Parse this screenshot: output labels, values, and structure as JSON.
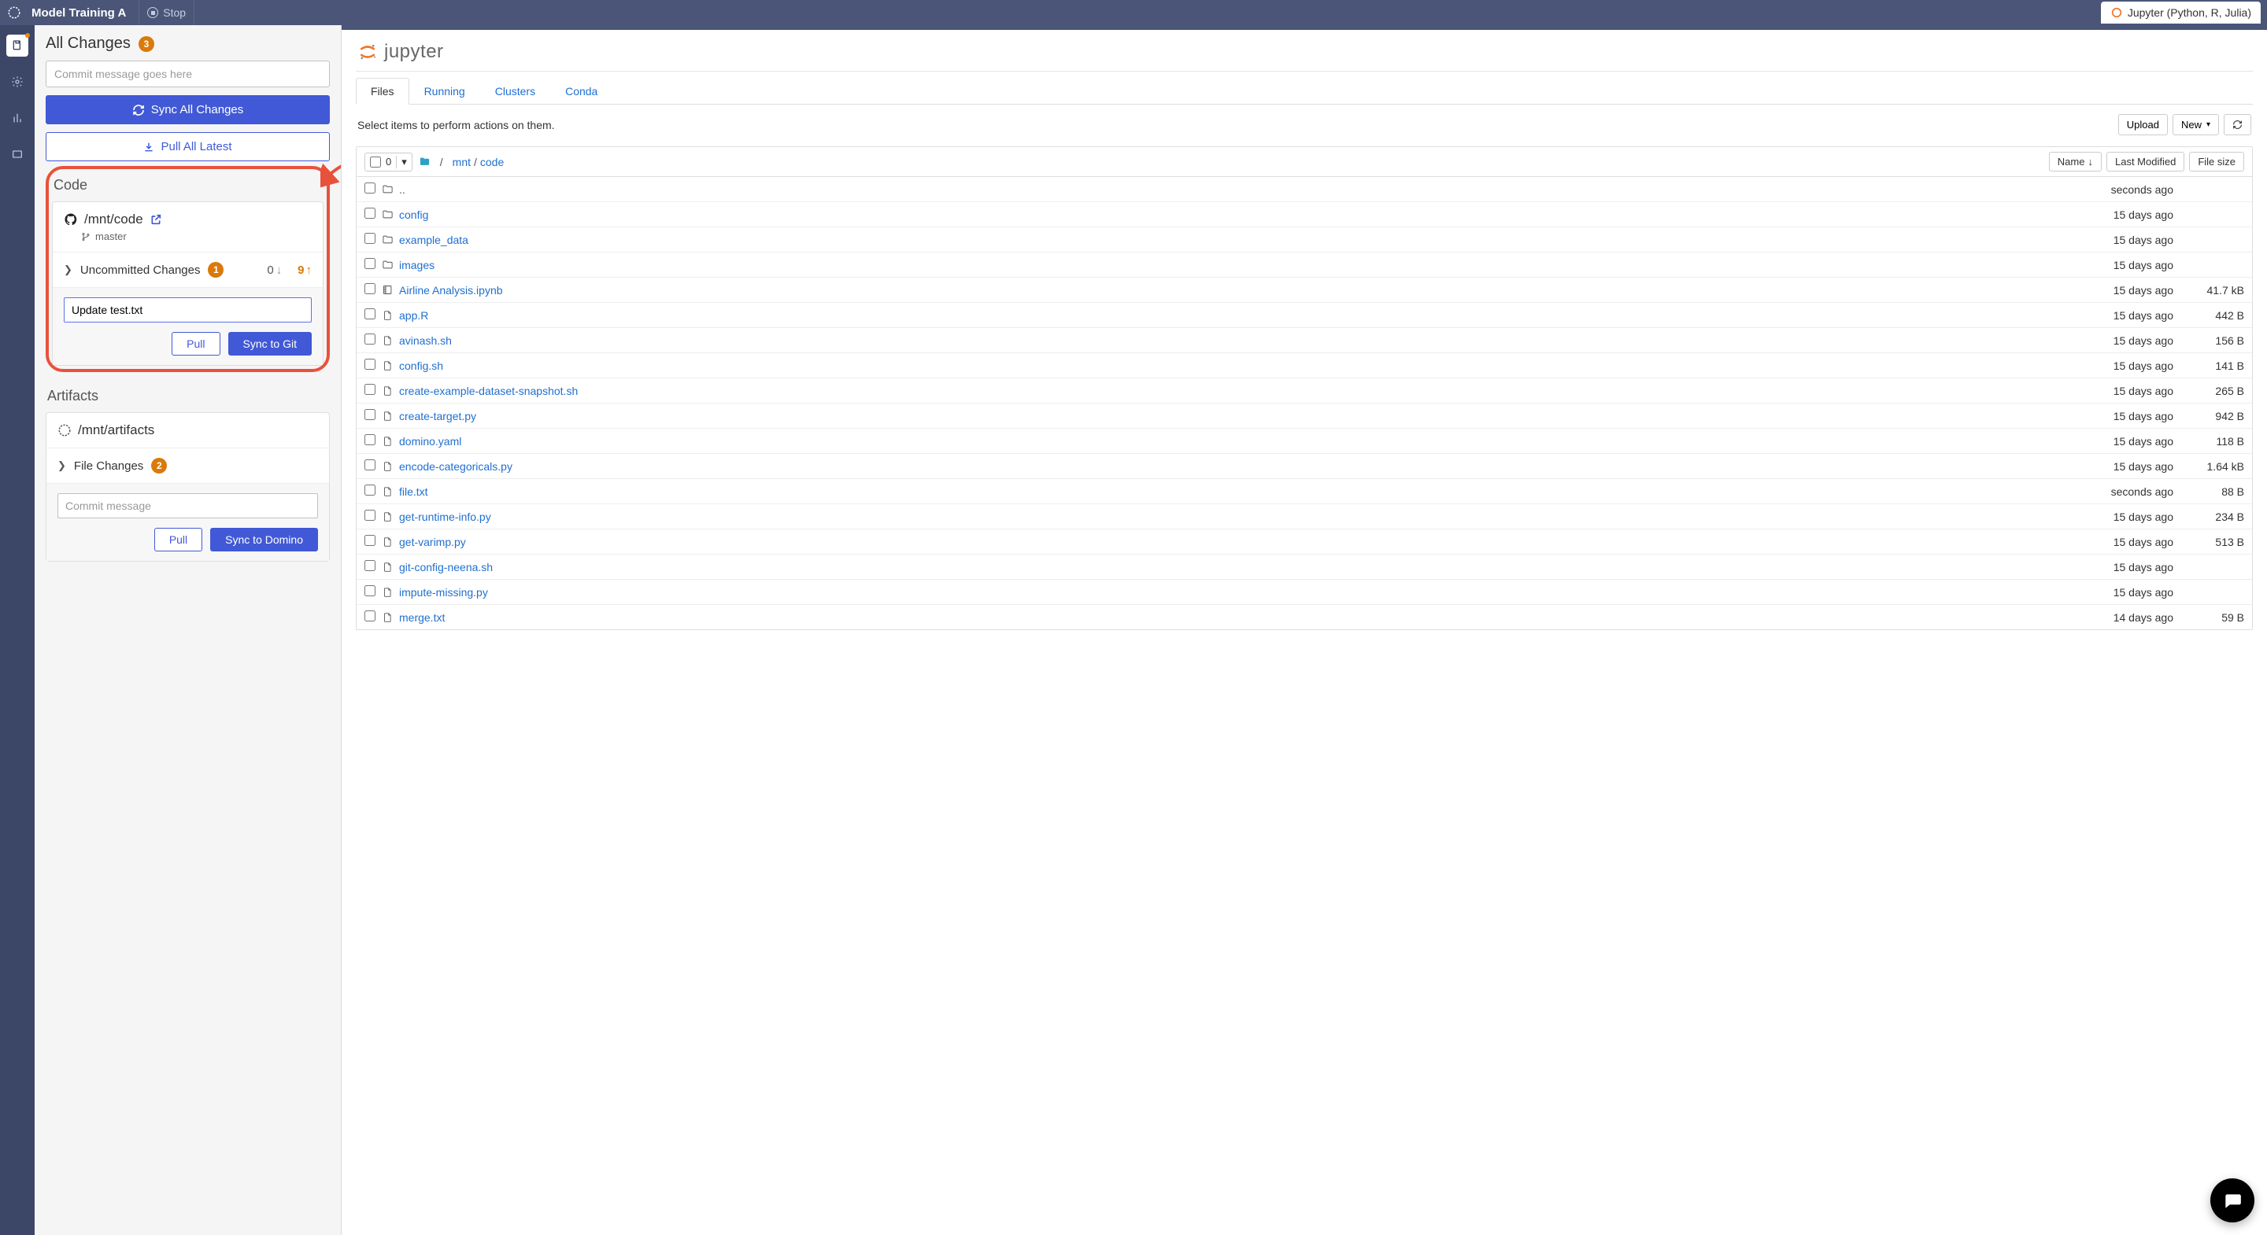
{
  "topbar": {
    "title": "Model Training A",
    "stop_label": "Stop",
    "right_label": "Jupyter (Python, R, Julia)"
  },
  "sidebar": {
    "all_changes_title": "All Changes",
    "all_changes_badge": "3",
    "commit_placeholder": "Commit message goes here",
    "sync_all_label": "Sync All Changes",
    "pull_all_label": "Pull All Latest",
    "code": {
      "section_title": "Code",
      "repo_path": "/mnt/code",
      "branch": "master",
      "uncommitted_label": "Uncommitted Changes",
      "uncommitted_badge": "1",
      "down_count": "0",
      "up_count": "9",
      "commit_value": "Update test.txt",
      "pull_label": "Pull",
      "sync_label": "Sync to Git"
    },
    "artifacts": {
      "section_title": "Artifacts",
      "repo_path": "/mnt/artifacts",
      "file_changes_label": "File Changes",
      "file_changes_badge": "2",
      "commit_placeholder": "Commit message",
      "pull_label": "Pull",
      "sync_label": "Sync to Domino"
    }
  },
  "jupyter": {
    "word": "jupyter",
    "tabs": [
      "Files",
      "Running",
      "Clusters",
      "Conda"
    ],
    "active_tab": "Files",
    "hint": "Select items to perform actions on them.",
    "upload_label": "Upload",
    "new_label": "New",
    "sel_count": "0",
    "breadcrumb": [
      "mnt",
      "code"
    ],
    "col_name": "Name",
    "col_modified": "Last Modified",
    "col_size": "File size",
    "rows": [
      {
        "icon": "folder",
        "name": "..",
        "modified": "seconds ago",
        "size": "",
        "dim": true
      },
      {
        "icon": "folder",
        "name": "config",
        "modified": "15 days ago",
        "size": ""
      },
      {
        "icon": "folder",
        "name": "example_data",
        "modified": "15 days ago",
        "size": ""
      },
      {
        "icon": "folder",
        "name": "images",
        "modified": "15 days ago",
        "size": ""
      },
      {
        "icon": "notebook",
        "name": "Airline Analysis.ipynb",
        "modified": "15 days ago",
        "size": "41.7 kB"
      },
      {
        "icon": "file",
        "name": "app.R",
        "modified": "15 days ago",
        "size": "442 B"
      },
      {
        "icon": "file",
        "name": "avinash.sh",
        "modified": "15 days ago",
        "size": "156 B"
      },
      {
        "icon": "file",
        "name": "config.sh",
        "modified": "15 days ago",
        "size": "141 B"
      },
      {
        "icon": "file",
        "name": "create-example-dataset-snapshot.sh",
        "modified": "15 days ago",
        "size": "265 B"
      },
      {
        "icon": "file",
        "name": "create-target.py",
        "modified": "15 days ago",
        "size": "942 B"
      },
      {
        "icon": "file",
        "name": "domino.yaml",
        "modified": "15 days ago",
        "size": "118 B"
      },
      {
        "icon": "file",
        "name": "encode-categoricals.py",
        "modified": "15 days ago",
        "size": "1.64 kB"
      },
      {
        "icon": "file",
        "name": "file.txt",
        "modified": "seconds ago",
        "size": "88 B"
      },
      {
        "icon": "file",
        "name": "get-runtime-info.py",
        "modified": "15 days ago",
        "size": "234 B"
      },
      {
        "icon": "file",
        "name": "get-varimp.py",
        "modified": "15 days ago",
        "size": "513 B"
      },
      {
        "icon": "file",
        "name": "git-config-neena.sh",
        "modified": "15 days ago",
        "size": ""
      },
      {
        "icon": "file",
        "name": "impute-missing.py",
        "modified": "15 days ago",
        "size": ""
      },
      {
        "icon": "file",
        "name": "merge.txt",
        "modified": "14 days ago",
        "size": "59 B"
      }
    ]
  }
}
